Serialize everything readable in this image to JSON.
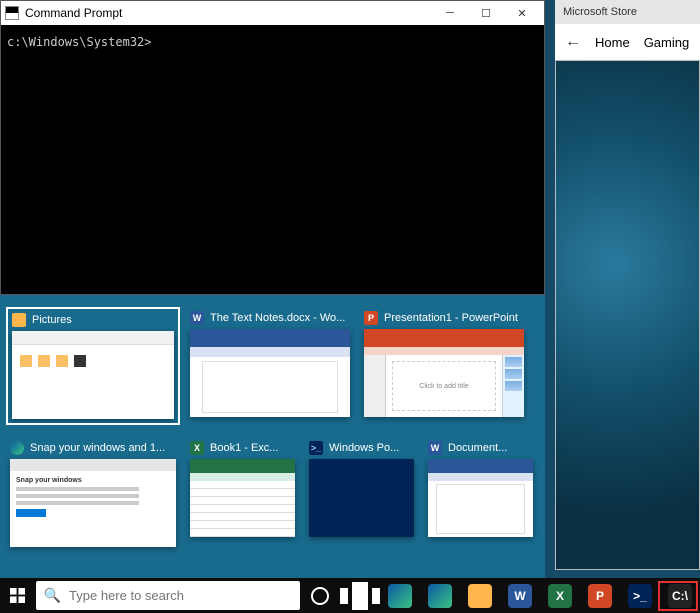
{
  "cmd": {
    "title": "Command Prompt",
    "prompt": "c:\\Windows\\System32>"
  },
  "store": {
    "title": "Microsoft Store",
    "tabs": {
      "home": "Home",
      "gaming": "Gaming"
    }
  },
  "snap": {
    "row1": [
      {
        "icon": "folder",
        "label": "Pictures"
      },
      {
        "icon": "word",
        "label": "The Text Notes.docx - Wo..."
      },
      {
        "icon": "pp",
        "label": "Presentation1 - PowerPoint"
      }
    ],
    "row2": [
      {
        "icon": "edge",
        "label": "Snap your windows and 1..."
      },
      {
        "icon": "excel",
        "label": "Book1 - Exc..."
      },
      {
        "icon": "ps",
        "label": "Windows Po..."
      },
      {
        "icon": "word",
        "label": "Document..."
      }
    ],
    "pp_slide_text": "Click to add title",
    "edge_heading": "Snap your windows"
  },
  "taskbar": {
    "search_placeholder": "Type here to search"
  }
}
